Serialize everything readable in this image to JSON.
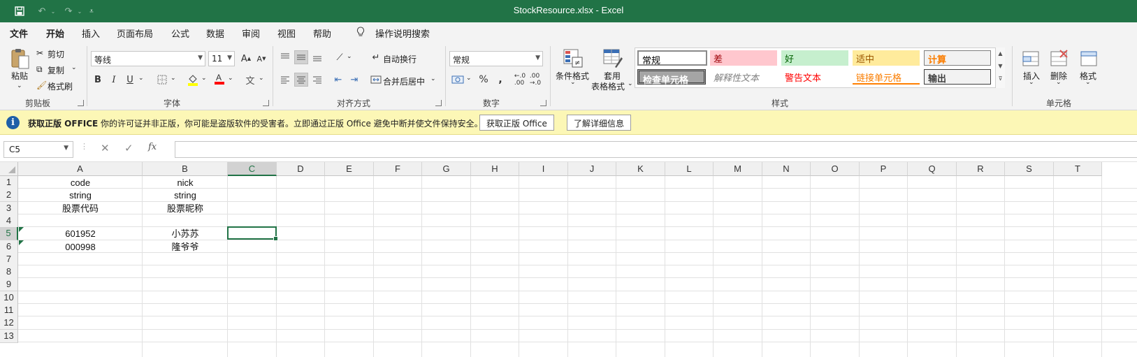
{
  "app": {
    "title": "StockResource.xlsx  -  Excel",
    "accent_color": "#217346"
  },
  "quick_access": [
    {
      "name": "save-icon",
      "glyph": "🖫"
    },
    {
      "name": "undo-icon",
      "glyph": "↶"
    },
    {
      "name": "redo-icon",
      "glyph": "↷"
    },
    {
      "name": "customize-qat-icon",
      "glyph": "⌄"
    }
  ],
  "tabs": [
    "文件",
    "开始",
    "插入",
    "页面布局",
    "公式",
    "数据",
    "审阅",
    "视图",
    "帮助",
    "操作说明搜索"
  ],
  "active_tab": "开始",
  "ribbon": {
    "clipboard": {
      "paste": "粘贴",
      "cut": "剪切",
      "copy": "复制",
      "format_painter": "格式刷",
      "label": "剪贴板"
    },
    "font": {
      "family": "等线",
      "size": "11",
      "bold": "B",
      "italic": "I",
      "underline": "U",
      "label": "字体"
    },
    "alignment": {
      "wrap_text": "自动换行",
      "merge_center": "合并后居中",
      "label": "对齐方式"
    },
    "number": {
      "format": "常规",
      "label": "数字"
    },
    "styles": {
      "conditional_format": "条件格式",
      "table_format_1": "套用",
      "table_format_2": "表格格式",
      "label": "样式",
      "cells": [
        {
          "text": "常规",
          "style": "normal"
        },
        {
          "text": "差",
          "style": "bad"
        },
        {
          "text": "好",
          "style": "good"
        },
        {
          "text": "适中",
          "style": "neutral"
        },
        {
          "text": "计算",
          "style": "calc"
        },
        {
          "text": "检查单元格",
          "style": "check"
        },
        {
          "text": "解释性文本",
          "style": "explanatory"
        },
        {
          "text": "警告文本",
          "style": "warning"
        },
        {
          "text": "链接单元格",
          "style": "linked"
        },
        {
          "text": "输出",
          "style": "output"
        }
      ]
    },
    "cells_group": {
      "insert": "插入",
      "delete": "删除",
      "format": "格式",
      "label": "单元格"
    }
  },
  "infobar": {
    "title": "获取正版 OFFICE",
    "message": "你的许可证并非正版，你可能是盗版软件的受害者。立即通过正版 Office 避免中断并使文件保持安全。",
    "button_primary": "获取正版 Office",
    "button_secondary": "了解详细信息"
  },
  "formula_bar": {
    "name_box": "C5",
    "fx": "fx",
    "value": ""
  },
  "sheet": {
    "columns": [
      "A",
      "B",
      "C",
      "D",
      "E",
      "F",
      "G",
      "H",
      "I",
      "J",
      "K",
      "L",
      "M",
      "N",
      "O",
      "P",
      "Q",
      "R",
      "S",
      "T"
    ],
    "rows": [
      "1",
      "2",
      "3",
      "4",
      "5",
      "6",
      "7",
      "8",
      "9",
      "10",
      "11",
      "12",
      "13"
    ],
    "selected_column": "C",
    "selected_row": "5",
    "active_cell": "C5",
    "cells": {
      "A1": "code",
      "B1": "nick",
      "A2": "string",
      "B2": "string",
      "A3": "股票代码",
      "B3": "股票昵称",
      "A5": "601952",
      "B5": "小苏苏",
      "A6": "000998",
      "B6": "隆爷爷"
    }
  }
}
